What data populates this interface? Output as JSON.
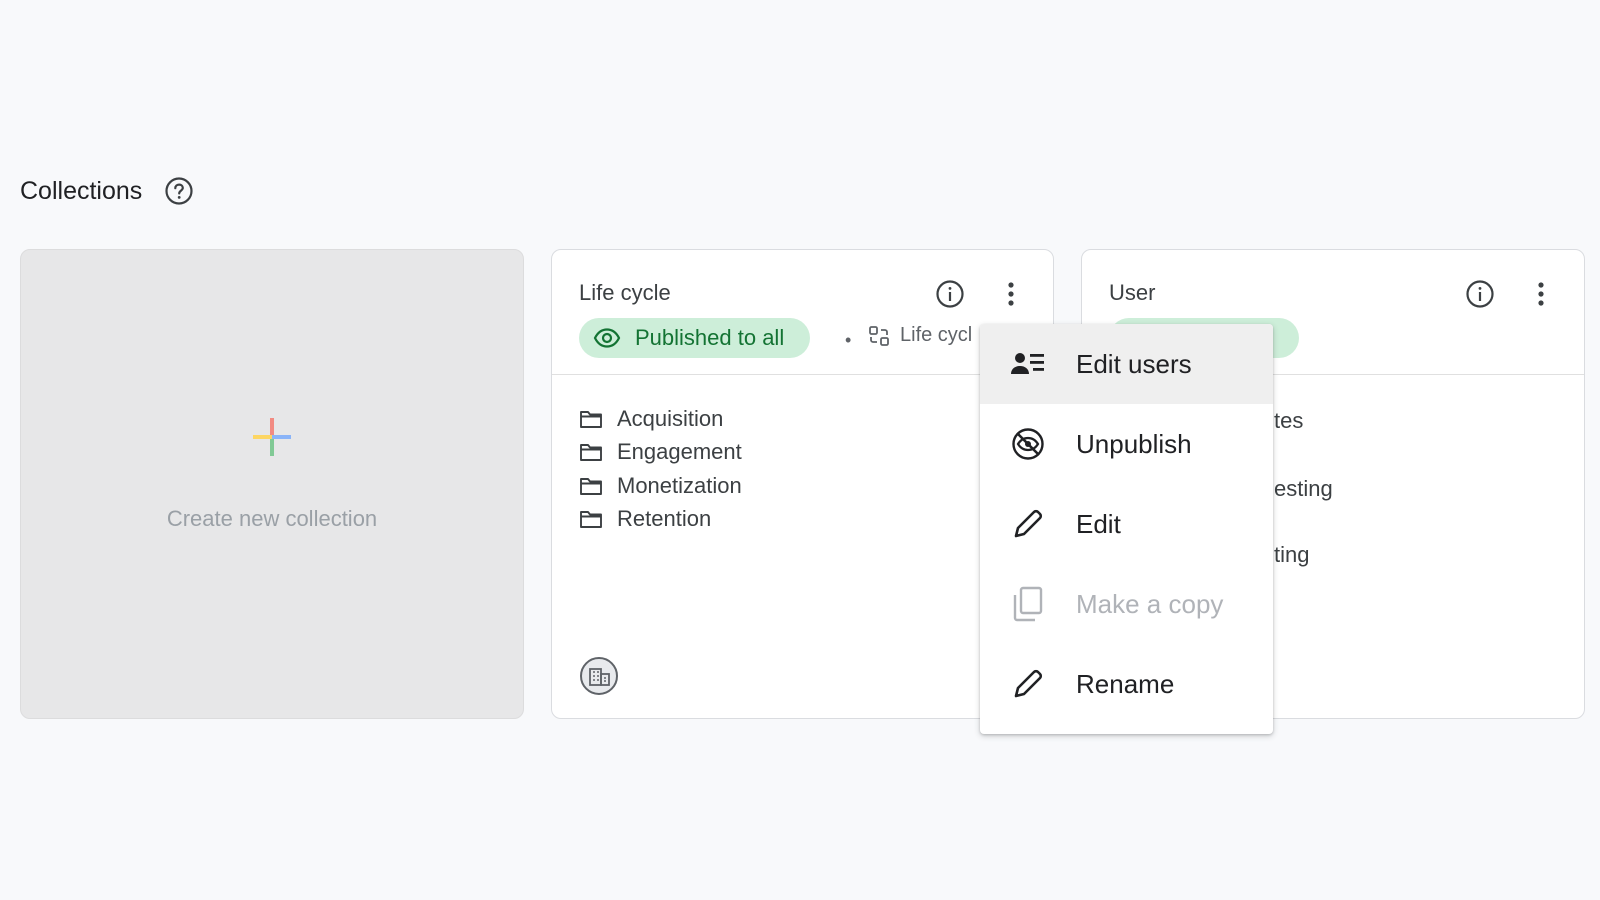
{
  "header": {
    "title": "Collections",
    "help_icon": "help-circle-icon"
  },
  "create_card": {
    "label": "Create new collection",
    "icon": "plus-icon"
  },
  "lifecycle_card": {
    "title": "Life cycle",
    "status": "Published to all",
    "meta_label": "Life cycl",
    "topics": [
      "Acquisition",
      "Engagement",
      "Monetization",
      "Retention"
    ]
  },
  "user_card": {
    "title": "User",
    "partial_items": [
      "tes",
      "esting",
      "ting"
    ]
  },
  "menu": {
    "items": [
      {
        "label": "Edit users",
        "icon": "manage-accounts-icon",
        "disabled": false
      },
      {
        "label": "Unpublish",
        "icon": "visibility-off-icon",
        "disabled": false
      },
      {
        "label": "Edit",
        "icon": "pencil-icon",
        "disabled": false
      },
      {
        "label": "Make a copy",
        "icon": "copy-icon",
        "disabled": true
      },
      {
        "label": "Rename",
        "icon": "pencil-icon",
        "disabled": false
      }
    ]
  },
  "colors": {
    "published_bg": "#cdeed9",
    "published_text": "#137333",
    "background": "#f8f9fb"
  }
}
